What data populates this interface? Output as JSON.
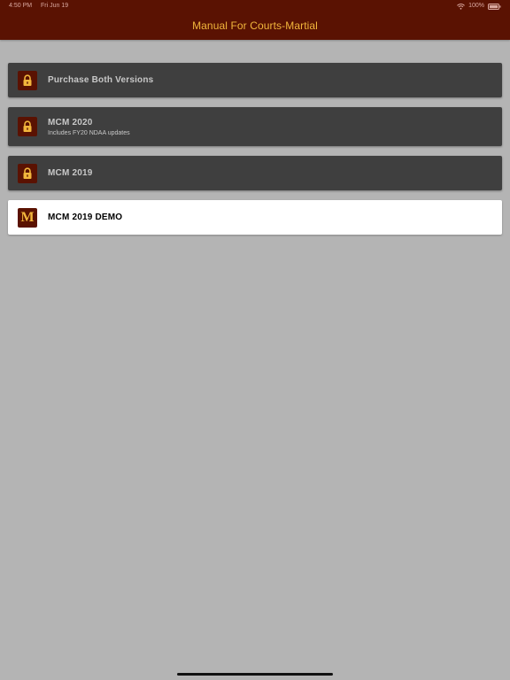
{
  "status_bar": {
    "time": "4:50 PM",
    "date": "Fri Jun 19",
    "battery": "100%",
    "icons": [
      "wifi-icon",
      "battery-icon"
    ]
  },
  "nav": {
    "title": "Manual For Courts-Martial"
  },
  "colors": {
    "nav_background": "#5a1202",
    "accent": "#f2b63c",
    "row_locked": "#3f3f3f",
    "row_active": "#ffffff",
    "page_background": "#b4b4b4"
  },
  "items": [
    {
      "title": "Purchase Both Versions",
      "subtitle": "",
      "icon": "lock-icon",
      "locked": true
    },
    {
      "title": "MCM 2020",
      "subtitle": "Includes FY20 NDAA updates",
      "icon": "lock-icon",
      "locked": true
    },
    {
      "title": "MCM 2019",
      "subtitle": "",
      "icon": "lock-icon",
      "locked": true
    },
    {
      "title": "MCM 2019 DEMO",
      "subtitle": "",
      "icon": "m-logo",
      "icon_text": "M",
      "locked": false
    }
  ]
}
